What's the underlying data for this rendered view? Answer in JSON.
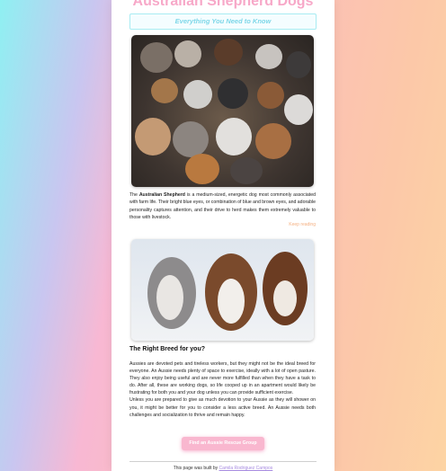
{
  "header": {
    "title": "Australian Shepherd Dogs",
    "subtitle": "Everything You Need to Know"
  },
  "intro": {
    "prefix": "The ",
    "breed": "Australian Shepherd",
    "text": " is a medium-sized, energetic dog most commonly associated with farm life. Their bright blue eyes, or combination of blue and brown eyes, and adorable personality captures attention, and their drive to herd makes them extremely valuable to those with livestock.",
    "keep_reading": "Keep reading"
  },
  "section": {
    "heading": "The Right Breed for you?",
    "paragraph1": "Aussies are devoted pets and tireless workers, but they might not be the ideal breed for everyone. An Aussie needs plenty of space to exercise, ideally with a lot of open pasture. They also enjoy being useful and are never more fulfilled than when they have a task to do. After all, these are working dogs, so life cooped up in an apartment would likely be frustrating for both you and your dog unless you can provide sufficient exercise.",
    "paragraph2": "Unless you are prepared to give as much devotion to your Aussie as they will shower on you, it might be better for you to consider a less active breed. An Aussie needs both challenges and socialization to thrive and remain happy."
  },
  "cta": {
    "button_label": "Find an Aussie Rescue Group"
  },
  "footer": {
    "prefix": "This page was built by ",
    "author": "Camila Rodriguez Campos"
  },
  "colors": {
    "title": "#f7a8c8",
    "subtitle": "#7ed7e8",
    "button": "#f9b7cf",
    "keep_reading": "#f5b183",
    "link": "#a78be0"
  }
}
